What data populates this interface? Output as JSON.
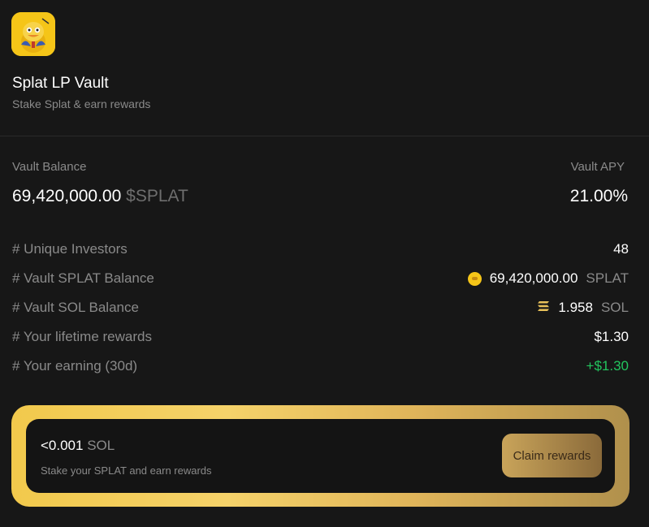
{
  "vault": {
    "name": "Splat LP Vault",
    "description": "Stake Splat & earn rewards"
  },
  "summary": {
    "balance_label": "Vault Balance",
    "balance_value": "69,420,000.00",
    "balance_unit": "$SPLAT",
    "apy_label": "Vault APY",
    "apy_value": "21.00%"
  },
  "stats": [
    {
      "label": "# Unique Investors",
      "value": "48"
    },
    {
      "label": "# Vault SPLAT Balance",
      "value": "69,420,000.00",
      "unit": "SPLAT",
      "icon": "splat-coin-icon"
    },
    {
      "label": "# Vault SOL Balance",
      "value": "1.958",
      "unit": "SOL",
      "icon": "solana-icon"
    },
    {
      "label": "# Your lifetime rewards",
      "value": "$1.30"
    },
    {
      "label": "# Your earning (30d)",
      "value": "+$1.30",
      "color": "#22c55e"
    }
  ],
  "rewards": {
    "amount": "<0.001",
    "unit": "SOL",
    "description": "Stake your SPLAT and earn rewards",
    "claim_label": "Claim rewards"
  },
  "colors": {
    "background": "#171717",
    "positive": "#22c55e",
    "accent_gold": "#f2c94c"
  }
}
